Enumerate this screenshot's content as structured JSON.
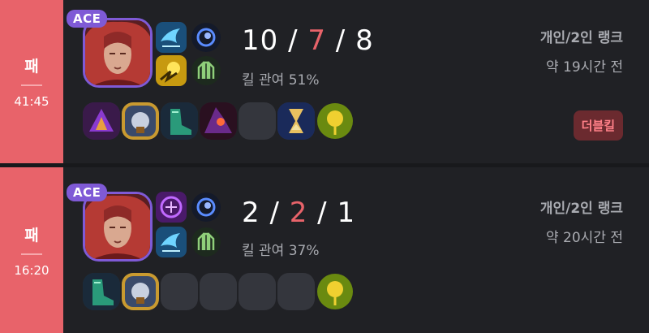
{
  "matches": [
    {
      "result": "패",
      "duration": "41:45",
      "ace_label": "ACE",
      "kills": "10",
      "deaths": "7",
      "assists": "8",
      "kda_sep": " / ",
      "kill_participation": "킬 관여 51%",
      "queue_type": "개인/2인 랭크",
      "time_ago": "약 19시간 전",
      "badge": "더블킬",
      "spells": [
        "ghost-spell-icon",
        "flash-spell-icon"
      ],
      "runes": [
        "arcane-comet-rune-icon",
        "resolve-rune-icon"
      ],
      "items": [
        "luden-item-icon",
        "zhonya-item-icon",
        "boots-item-icon",
        "rabadon-item-icon",
        "empty",
        "stopwatch-item-icon",
        "ward-trinket-icon"
      ]
    },
    {
      "result": "패",
      "duration": "16:20",
      "ace_label": "ACE",
      "kills": "2",
      "deaths": "2",
      "assists": "1",
      "kda_sep": " / ",
      "kill_participation": "킬 관여 37%",
      "queue_type": "개인/2인 랭크",
      "time_ago": "약 20시간 전",
      "spells": [
        "teleport-spell-icon",
        "ghost-spell-icon"
      ],
      "runes": [
        "arcane-comet-rune-icon",
        "resolve-rune-icon"
      ],
      "items": [
        "boots-item-icon",
        "zhonya-item-icon",
        "empty",
        "empty",
        "empty",
        "empty",
        "ward-trinket-icon"
      ]
    }
  ],
  "colors": {
    "loss": "#e8636a",
    "ace": "#7f5ad6",
    "badge_bg": "#6b2a2f",
    "badge_text": "#ff8088"
  }
}
